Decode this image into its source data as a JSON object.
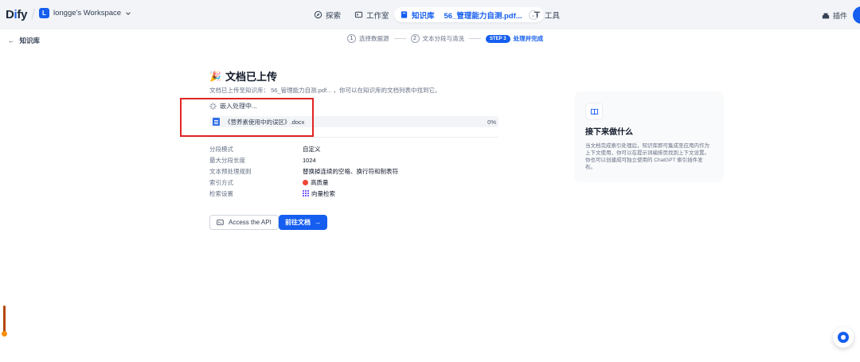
{
  "nav": {
    "logo": {
      "pre": "D",
      "i": "i",
      "post": "fy"
    },
    "workspace_badge": "L",
    "workspace_name": "longge's Workspace",
    "explore": "探索",
    "studio": "工作室",
    "knowledge": "知识库",
    "dataset_name": "56_管理能力自测.pdf...",
    "tools": "工具",
    "plugins": "插件"
  },
  "subheader": {
    "back_label": "知识库",
    "steps": [
      {
        "num": "1",
        "label": "选择数据源"
      },
      {
        "num": "2",
        "label": "文本分段与清洗"
      },
      {
        "pill": "STEP 3",
        "label": "处理并完成"
      }
    ]
  },
  "main": {
    "emoji": "🎉",
    "title": "文档已上传",
    "subtitle": "文档已上传至知识库： 56_管理能力自测.pdf... ，你可以在知识库的文档列表中找到它。",
    "processing_label": "嵌入处理中...",
    "file_name": "《营养素使用中的误区》.docx",
    "progress_text": "0%",
    "progress": 0,
    "meta": [
      {
        "label": "分段模式",
        "value": "自定义"
      },
      {
        "label": "最大分段长度",
        "value": "1024"
      },
      {
        "label": "文本预处理规则",
        "value": "替换掉连续的空格、换行符和制表符"
      },
      {
        "label": "索引方式",
        "value": "高质量",
        "icon": "high-quality-icon"
      },
      {
        "label": "检索设置",
        "value": "向量检索",
        "icon": "vector-grid-icon"
      }
    ],
    "api_button": "Access the API",
    "go_button": "前往文档"
  },
  "card": {
    "title": "接下来做什么",
    "text": "当文档完成索引处理后，知识库即可集成至应用内作为上下文使用，你可以在提示词编排页找到上下文设置。你也可以创建成可独立使用的 ChatGPT 索引插件发布。"
  },
  "colors": {
    "accent": "#155eef",
    "highlight_border": "#e02424"
  }
}
